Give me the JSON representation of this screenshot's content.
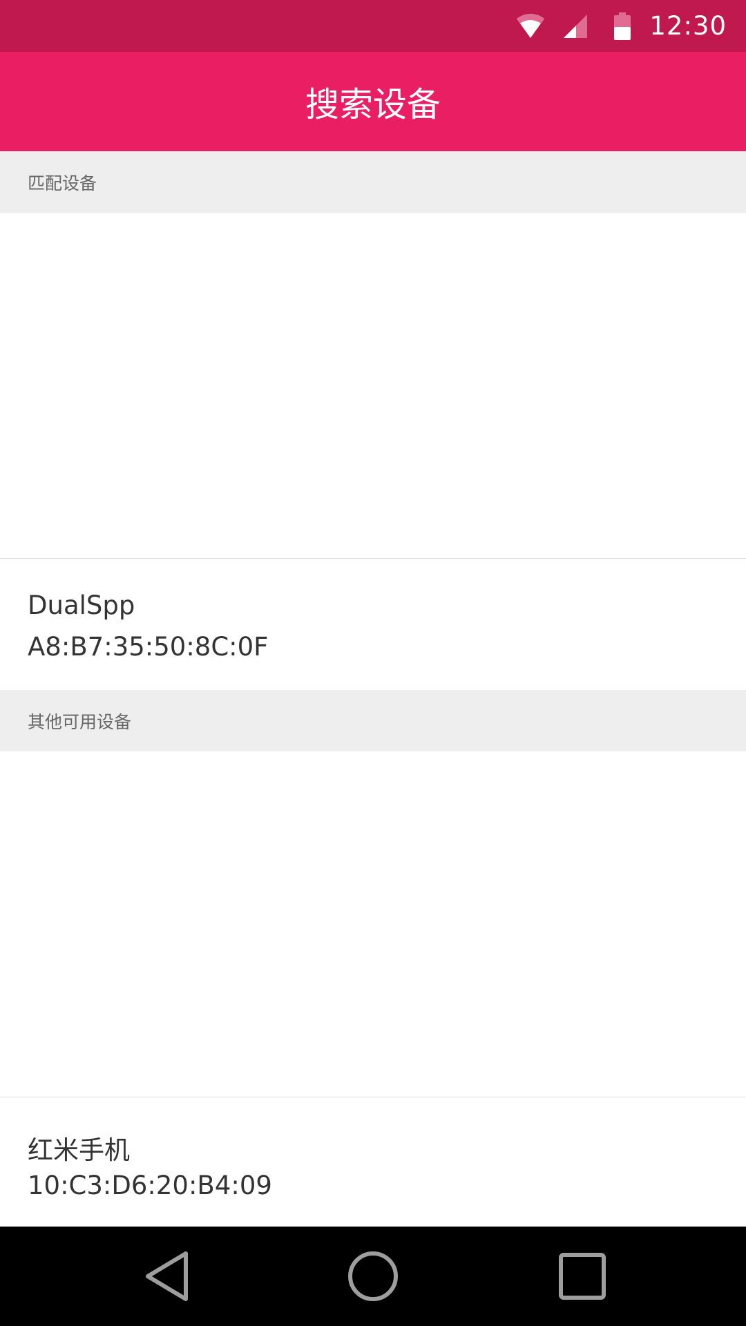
{
  "status_bar": {
    "time": "12:30",
    "icons": [
      "wifi-icon",
      "cell-signal-icon",
      "battery-icon"
    ]
  },
  "app_bar": {
    "title": "搜索设备"
  },
  "paired_section": {
    "header": "匹配设备",
    "devices": [
      {
        "name": "DualSpp",
        "address": "A8:B7:35:50:8C:0F"
      }
    ]
  },
  "available_section": {
    "header": "其他可用设备",
    "devices": [
      {
        "name": "红米手机",
        "address": "10:C3:D6:20:B4:09"
      }
    ]
  },
  "nav_bar": {
    "buttons": [
      "back-icon",
      "home-icon",
      "recents-icon"
    ]
  },
  "colors": {
    "status_bar": "#bf194f",
    "app_bar": "#e91e63",
    "section_header_bg": "#eeeeee",
    "nav_bar": "#000000"
  }
}
